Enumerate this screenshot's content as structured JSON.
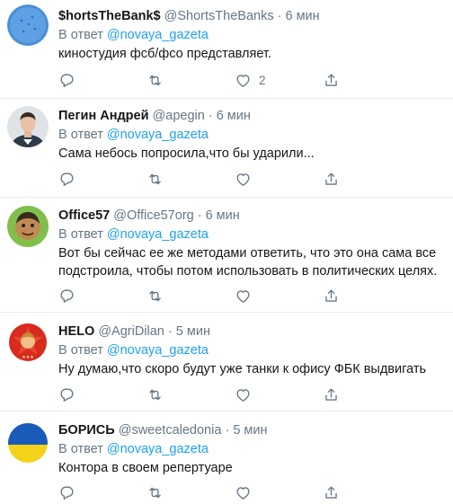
{
  "reply_prefix": "В ответ",
  "tweets": [
    {
      "name": "$hortsTheBank$",
      "handle": "@ShortsTheBanks",
      "dot": "·",
      "time": "6 мин",
      "reply_to": "@novaya_gazeta",
      "text_lines": [
        "киностудия фсб/фсо представляет."
      ],
      "like_count": "2"
    },
    {
      "name": "Пегин Андрей",
      "handle": "@apegin",
      "dot": "·",
      "time": "6 мин",
      "reply_to": "@novaya_gazeta",
      "text_lines": [
        "Сама небось попросила,что бы ударили..."
      ],
      "like_count": ""
    },
    {
      "name": "Office57",
      "handle": "@Office57org",
      "dot": "·",
      "time": "6 мин",
      "reply_to": "@novaya_gazeta",
      "text_lines": [
        "Вот бы сейчас ее же методами ответить, что это она сама все",
        "подстроила, чтобы потом использовать в политических целях."
      ],
      "like_count": ""
    },
    {
      "name": "HELO",
      "handle": "@AgriDilan",
      "dot": "·",
      "time": "5 мин",
      "reply_to": "@novaya_gazeta",
      "text_lines": [
        "Ну думаю,что скоро будут уже танки к офису ФБК выдвигать"
      ],
      "like_count": ""
    },
    {
      "name": "БОРИСЬ",
      "handle": "@sweetcaledonia",
      "dot": "·",
      "time": "5 мин",
      "reply_to": "@novaya_gazeta",
      "text_lines": [
        "Контора в своем репертуаре"
      ],
      "like_count": ""
    }
  ],
  "icons": {
    "reply": "reply-icon",
    "retweet": "retweet-icon",
    "like": "like-icon",
    "share": "share-icon"
  },
  "colors": {
    "link": "#1da1f2",
    "secondary_text": "#657786",
    "divider": "#e6ecf0"
  }
}
